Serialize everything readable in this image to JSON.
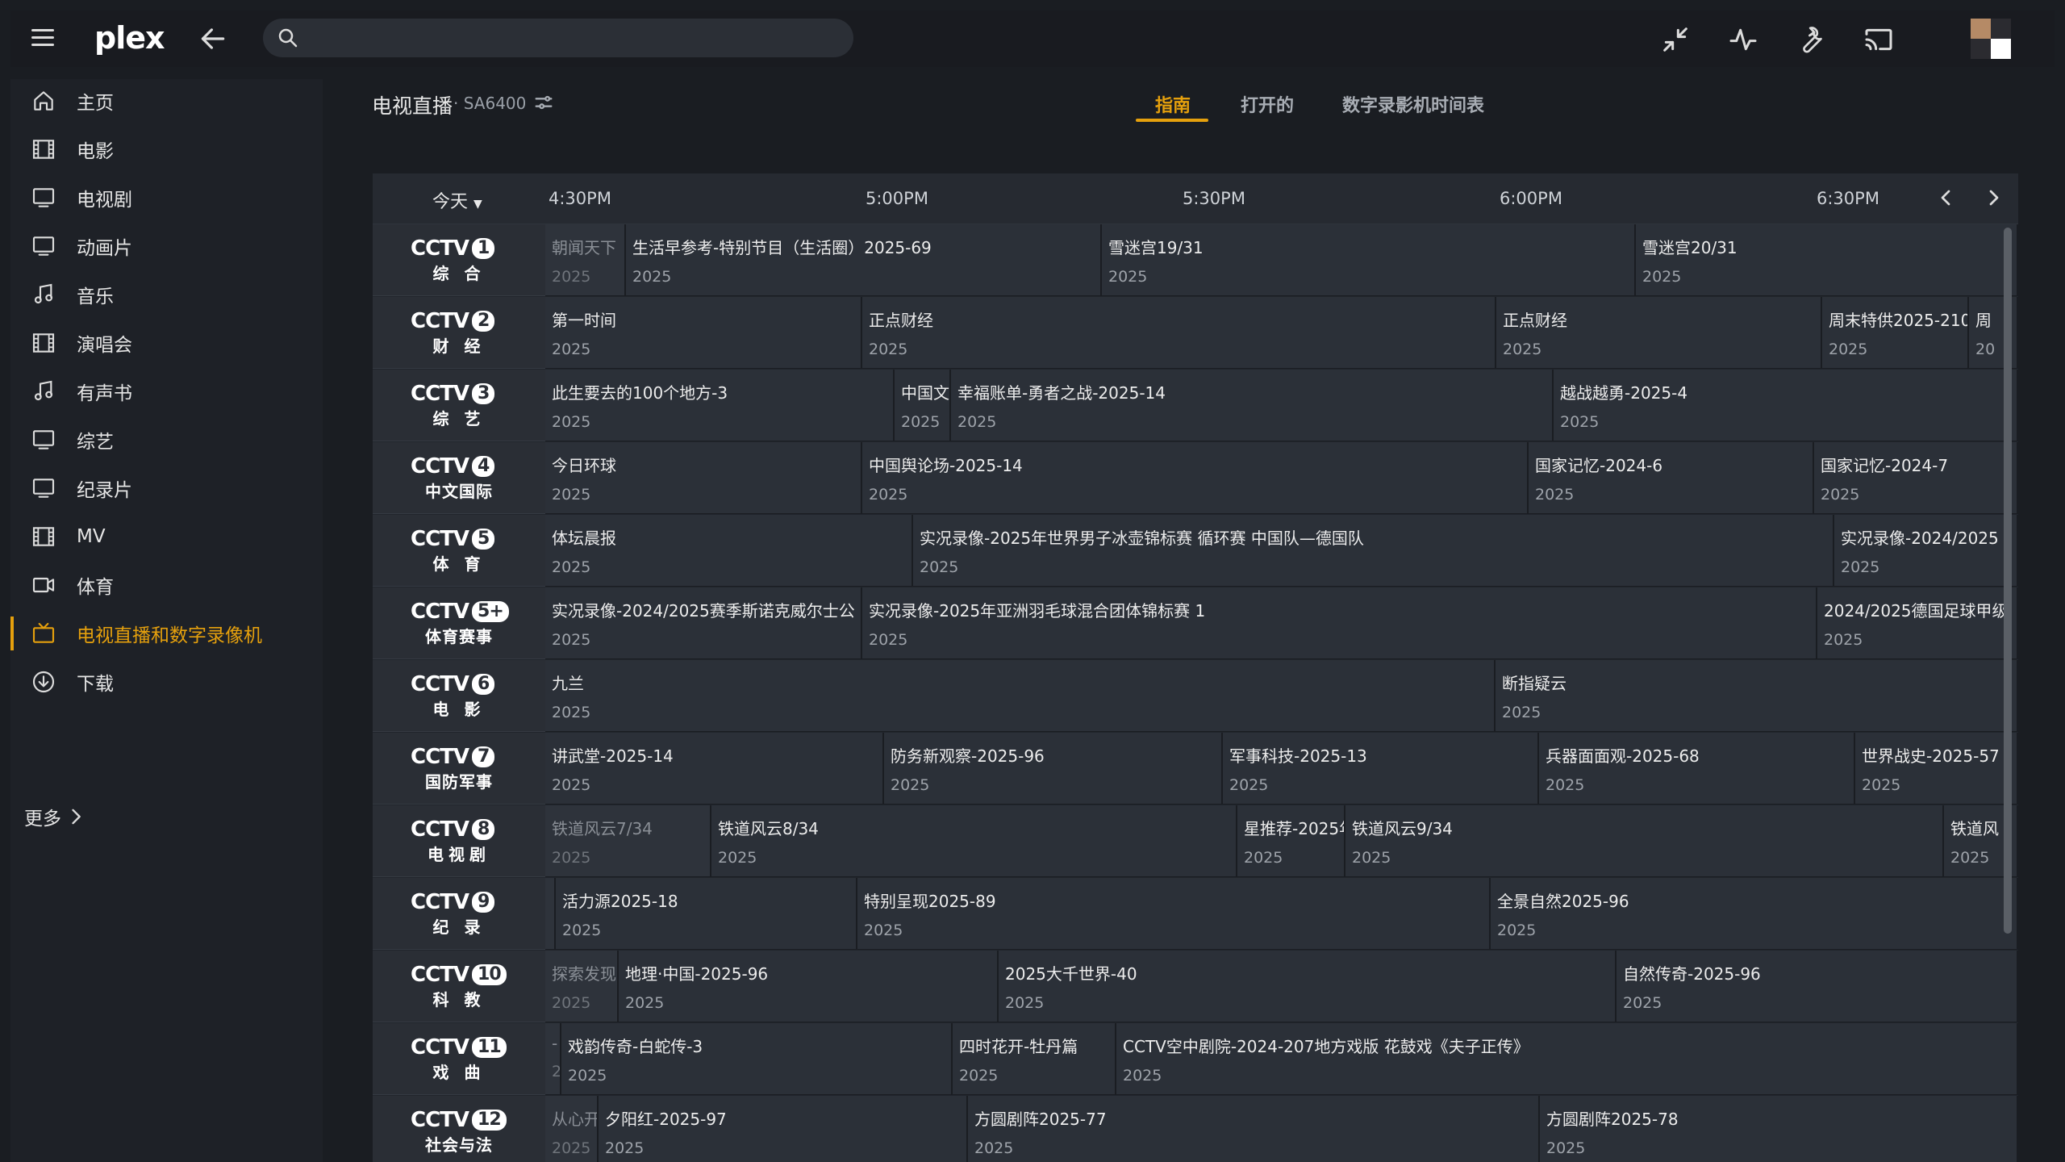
{
  "app": {
    "logo": "plex",
    "logo_accent": "#e5a00d"
  },
  "search": {
    "placeholder": "",
    "value": ""
  },
  "sidebar": {
    "items": [
      {
        "label": "主页",
        "icon": "home-icon"
      },
      {
        "label": "电影",
        "icon": "film-icon"
      },
      {
        "label": "电视剧",
        "icon": "tv-icon"
      },
      {
        "label": "动画片",
        "icon": "tv-icon"
      },
      {
        "label": "音乐",
        "icon": "music-icon"
      },
      {
        "label": "演唱会",
        "icon": "film-icon"
      },
      {
        "label": "有声书",
        "icon": "music-icon"
      },
      {
        "label": "综艺",
        "icon": "tv-icon"
      },
      {
        "label": "纪录片",
        "icon": "tv-icon"
      },
      {
        "label": "MV",
        "icon": "film-icon"
      },
      {
        "label": "体育",
        "icon": "video-camera-icon"
      },
      {
        "label": "电视直播和数字录像机",
        "icon": "live-tv-icon",
        "active": true
      },
      {
        "label": "下载",
        "icon": "download-icon"
      }
    ],
    "more_label": "更多"
  },
  "page": {
    "title": "电视直播",
    "subtitle": "· SA6400",
    "tabs": [
      {
        "label": "指南",
        "active": true
      },
      {
        "label": "打开的"
      },
      {
        "label": "数字录影机时间表"
      }
    ]
  },
  "guide": {
    "day": "今天",
    "times": [
      "4:30PM",
      "5:00PM",
      "5:30PM",
      "6:00PM",
      "6:30PM"
    ],
    "channels": [
      {
        "num": "1",
        "sub": "综 合",
        "programs": [
          {
            "title": "朝闻天下",
            "year": "2025",
            "past": true
          },
          {
            "title": "生活早参考-特别节目（生活圈）2025-69",
            "year": "2025"
          },
          {
            "title": "雪迷宫19/31",
            "year": "2025"
          },
          {
            "title": "雪迷宫20/31",
            "year": "2025"
          }
        ]
      },
      {
        "num": "2",
        "sub": "财 经",
        "programs": [
          {
            "title": "第一时间",
            "year": "2025"
          },
          {
            "title": "正点财经",
            "year": "2025"
          },
          {
            "title": "正点财经",
            "year": "2025"
          },
          {
            "title": "周末特供2025-210",
            "year": "2025"
          },
          {
            "title": "周",
            "year": "20"
          }
        ]
      },
      {
        "num": "3",
        "sub": "综 艺",
        "programs": [
          {
            "title": "此生要去的100个地方-3",
            "year": "2025"
          },
          {
            "title": "中国文",
            "year": "2025"
          },
          {
            "title": "幸福账单-勇者之战-2025-14",
            "year": "2025"
          },
          {
            "title": "越战越勇-2025-4",
            "year": "2025"
          }
        ]
      },
      {
        "num": "4",
        "sub": "中文国际",
        "programs": [
          {
            "title": "今日环球",
            "year": "2025"
          },
          {
            "title": "中国舆论场-2025-14",
            "year": "2025"
          },
          {
            "title": "国家记忆-2024-6",
            "year": "2025"
          },
          {
            "title": "国家记忆-2024-7",
            "year": "2025"
          }
        ]
      },
      {
        "num": "5",
        "sub": "体 育",
        "programs": [
          {
            "title": "体坛晨报",
            "year": "2025"
          },
          {
            "title": "实况录像-2025年世界男子冰壶锦标赛 循环赛 中国队—德国队",
            "year": "2025"
          },
          {
            "title": "实况录像-2024/2025",
            "year": "2025"
          }
        ]
      },
      {
        "num": "5+",
        "sub": "体育赛事",
        "programs": [
          {
            "title": "实况录像-2024/2025赛季斯诺克威尔士公",
            "year": "2025"
          },
          {
            "title": "实况录像-2025年亚洲羽毛球混合团体锦标赛 1",
            "year": "2025"
          },
          {
            "title": "2024/2025德国足球甲级",
            "year": "2025"
          }
        ]
      },
      {
        "num": "6",
        "sub": "电 影",
        "programs": [
          {
            "title": "九兰",
            "year": "2025"
          },
          {
            "title": "断指疑云",
            "year": "2025"
          }
        ]
      },
      {
        "num": "7",
        "sub": "国防军事",
        "programs": [
          {
            "title": "讲武堂-2025-14",
            "year": "2025"
          },
          {
            "title": "防务新观察-2025-96",
            "year": "2025"
          },
          {
            "title": "军事科技-2025-13",
            "year": "2025"
          },
          {
            "title": "兵器面面观-2025-68",
            "year": "2025"
          },
          {
            "title": "世界战史-2025-57",
            "year": "2025"
          }
        ]
      },
      {
        "num": "8",
        "sub": "电视剧",
        "programs": [
          {
            "title": "铁道风云7/34",
            "year": "2025",
            "past": true
          },
          {
            "title": "铁道风云8/34",
            "year": "2025"
          },
          {
            "title": "星推荐-2025年",
            "year": "2025"
          },
          {
            "title": "铁道风云9/34",
            "year": "2025"
          },
          {
            "title": "铁道风",
            "year": "2025"
          }
        ]
      },
      {
        "num": "9",
        "sub": "纪 录",
        "programs": [
          {
            "title": "",
            "year": "",
            "past": true
          },
          {
            "title": "活力源2025-18",
            "year": "2025"
          },
          {
            "title": "特别呈现2025-89",
            "year": "2025"
          },
          {
            "title": "全景自然2025-96",
            "year": "2025"
          }
        ]
      },
      {
        "num": "10",
        "sub": "科 教",
        "programs": [
          {
            "title": "探索发现",
            "year": "2025",
            "past": true
          },
          {
            "title": "地理·中国-2025-96",
            "year": "2025"
          },
          {
            "title": "2025大千世界-40",
            "year": "2025"
          },
          {
            "title": "自然传奇-2025-96",
            "year": "2025"
          }
        ]
      },
      {
        "num": "11",
        "sub": "戏 曲",
        "programs": [
          {
            "title": "-",
            "year": "2",
            "past": true
          },
          {
            "title": "戏韵传奇-白蛇传-3",
            "year": "2025"
          },
          {
            "title": "四时花开-牡丹篇",
            "year": "2025"
          },
          {
            "title": "CCTV空中剧院-2024-207地方戏版 花鼓戏《夫子正传》",
            "year": "2025"
          }
        ]
      },
      {
        "num": "12",
        "sub": "社会与法",
        "programs": [
          {
            "title": "从心开",
            "year": "2025",
            "past": true
          },
          {
            "title": "夕阳红-2025-97",
            "year": "2025"
          },
          {
            "title": "方圆剧阵2025-77",
            "year": "2025"
          },
          {
            "title": "方圆剧阵2025-78",
            "year": "2025"
          }
        ]
      }
    ]
  }
}
